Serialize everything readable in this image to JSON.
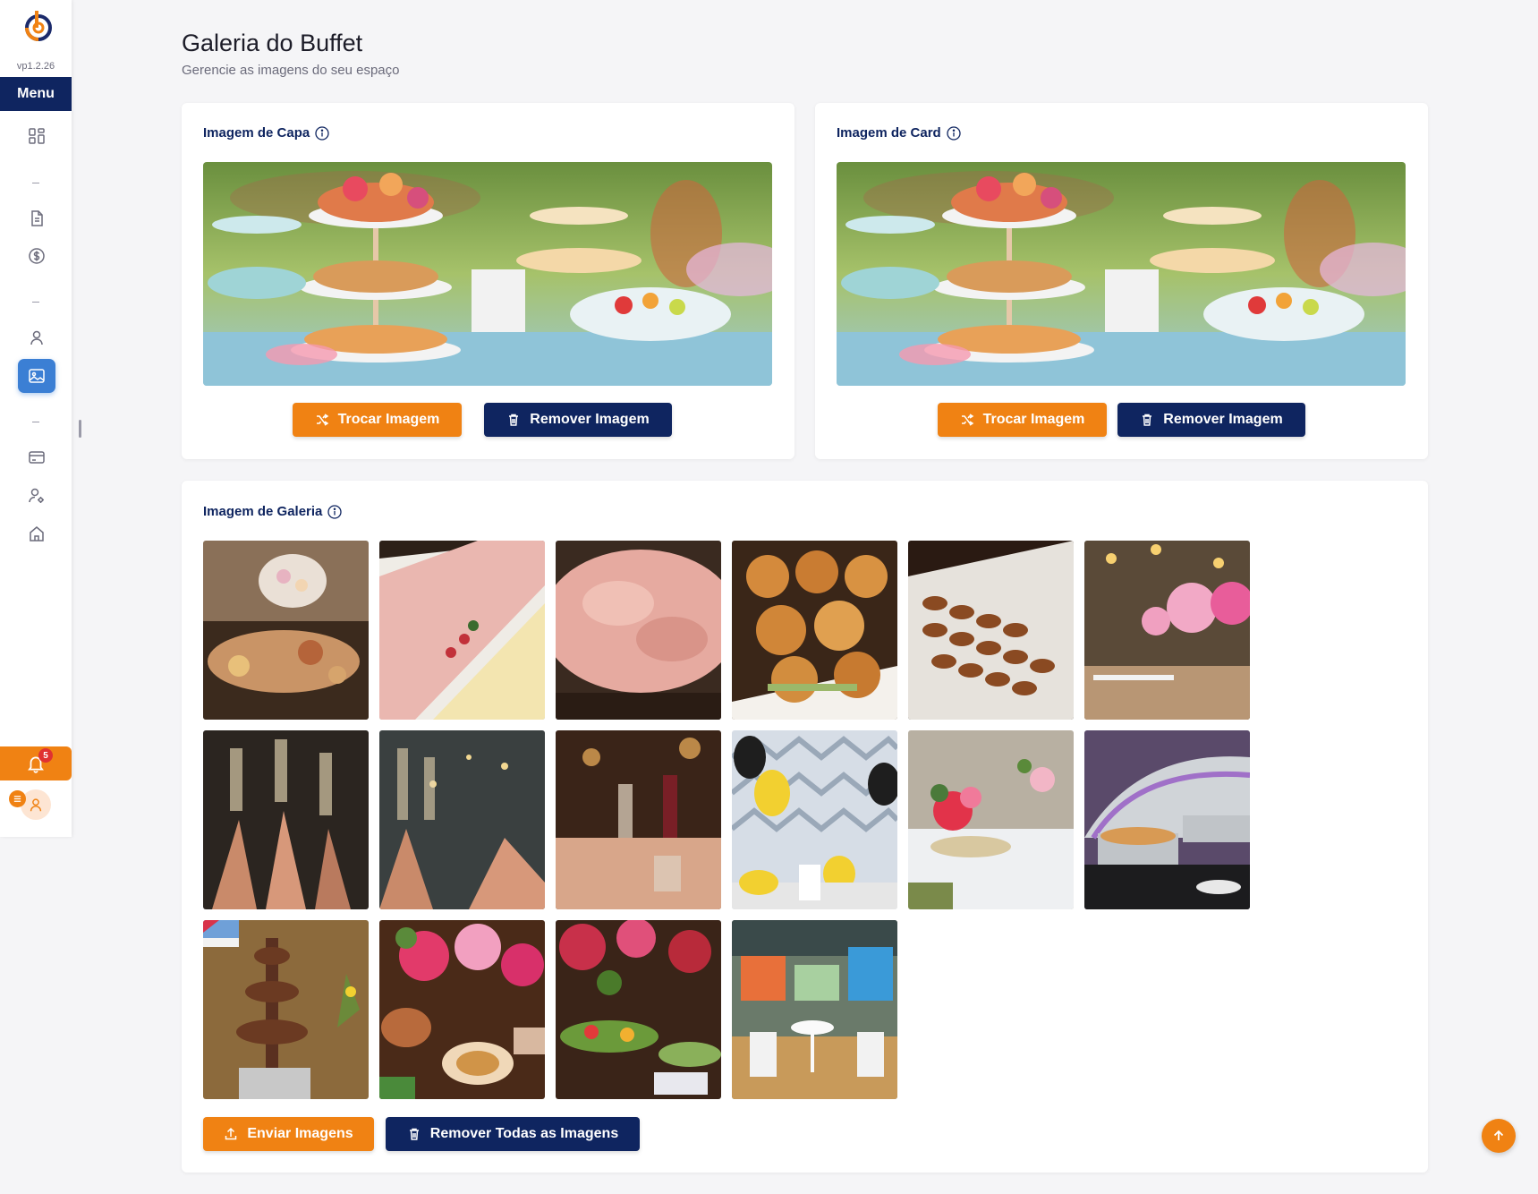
{
  "app": {
    "version": "vp1.2.26",
    "menu_label": "Menu",
    "notification_count": "5",
    "brand_colors": {
      "orange": "#f08213",
      "navy": "#0f2560",
      "active_blue": "#3b7fd4"
    }
  },
  "sidebar": {
    "items": [
      {
        "icon": "dashboard-icon"
      },
      {
        "icon": "document-icon"
      },
      {
        "icon": "dollar-icon"
      },
      {
        "icon": "user-icon"
      },
      {
        "icon": "image-icon",
        "active": true
      },
      {
        "icon": "credit-card-icon"
      },
      {
        "icon": "user-settings-icon"
      },
      {
        "icon": "home-icon"
      }
    ]
  },
  "header": {
    "title": "Galeria do Buffet",
    "subtitle": "Gerencie as imagens do seu espaço"
  },
  "cover": {
    "title": "Imagem de Capa",
    "change_label": "Trocar Imagem",
    "remove_label": "Remover Imagem"
  },
  "card_image": {
    "title": "Imagem de Card",
    "change_label": "Trocar Imagem",
    "remove_label": "Remover Imagem"
  },
  "gallery": {
    "title": "Imagem de Galeria",
    "upload_label": "Enviar Imagens",
    "remove_all_label": "Remover Todas as Imagens",
    "images": [
      "buffet-table-flowers",
      "ham-cheese-platter",
      "cold-cuts-platter",
      "bread-rolls",
      "croquettes",
      "pink-flower-centerpieces",
      "champagne-toast",
      "glitter-toast",
      "wine-glasses-dinner",
      "balloons-kids-party",
      "floral-table-decor",
      "chafing-dishes",
      "chocolate-fountain",
      "floral-buffet-spread",
      "garden-buffet",
      "kids-party-hall"
    ]
  }
}
